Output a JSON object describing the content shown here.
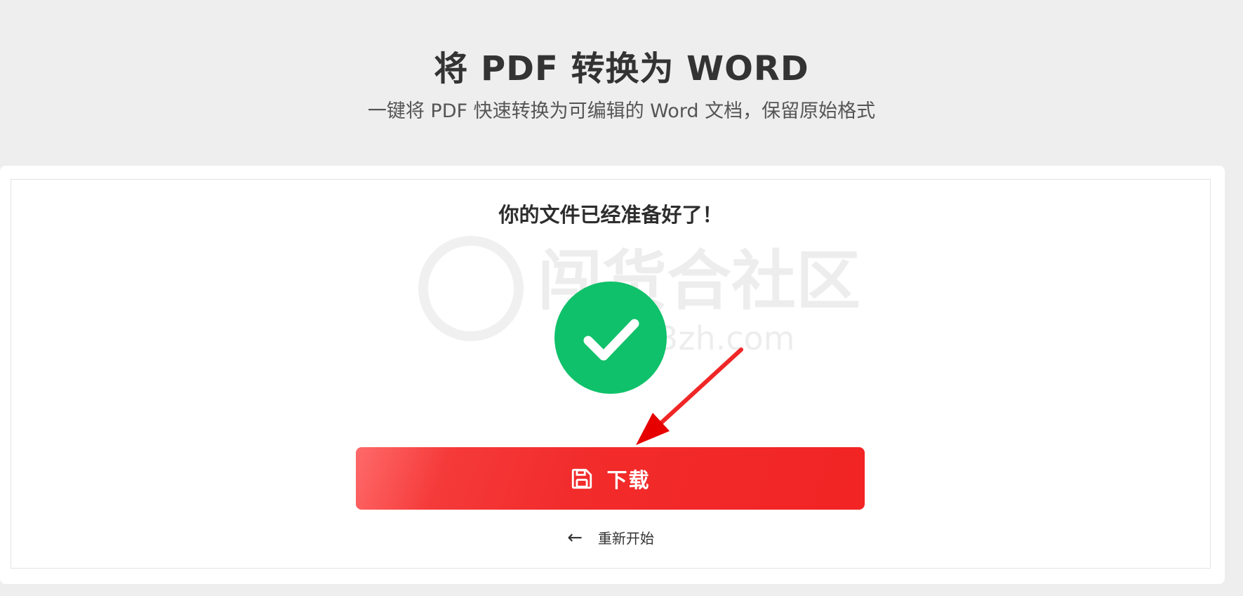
{
  "header": {
    "title": "将 PDF 转换为 WORD",
    "subtitle": "一键将 PDF 快速转换为可编辑的 Word 文档，保留原始格式"
  },
  "result": {
    "ready_text": "你的文件已经准备好了！",
    "success_icon": "check-circle-icon",
    "success_color": "#0fc16a"
  },
  "watermark": {
    "text": "闯货合社区",
    "url": "www.i3zh.com"
  },
  "actions": {
    "download_label": "下载",
    "download_icon": "floppy-disk-icon",
    "download_color": "#f22b2b",
    "restart_arrow": "←",
    "restart_label": "重新开始"
  }
}
